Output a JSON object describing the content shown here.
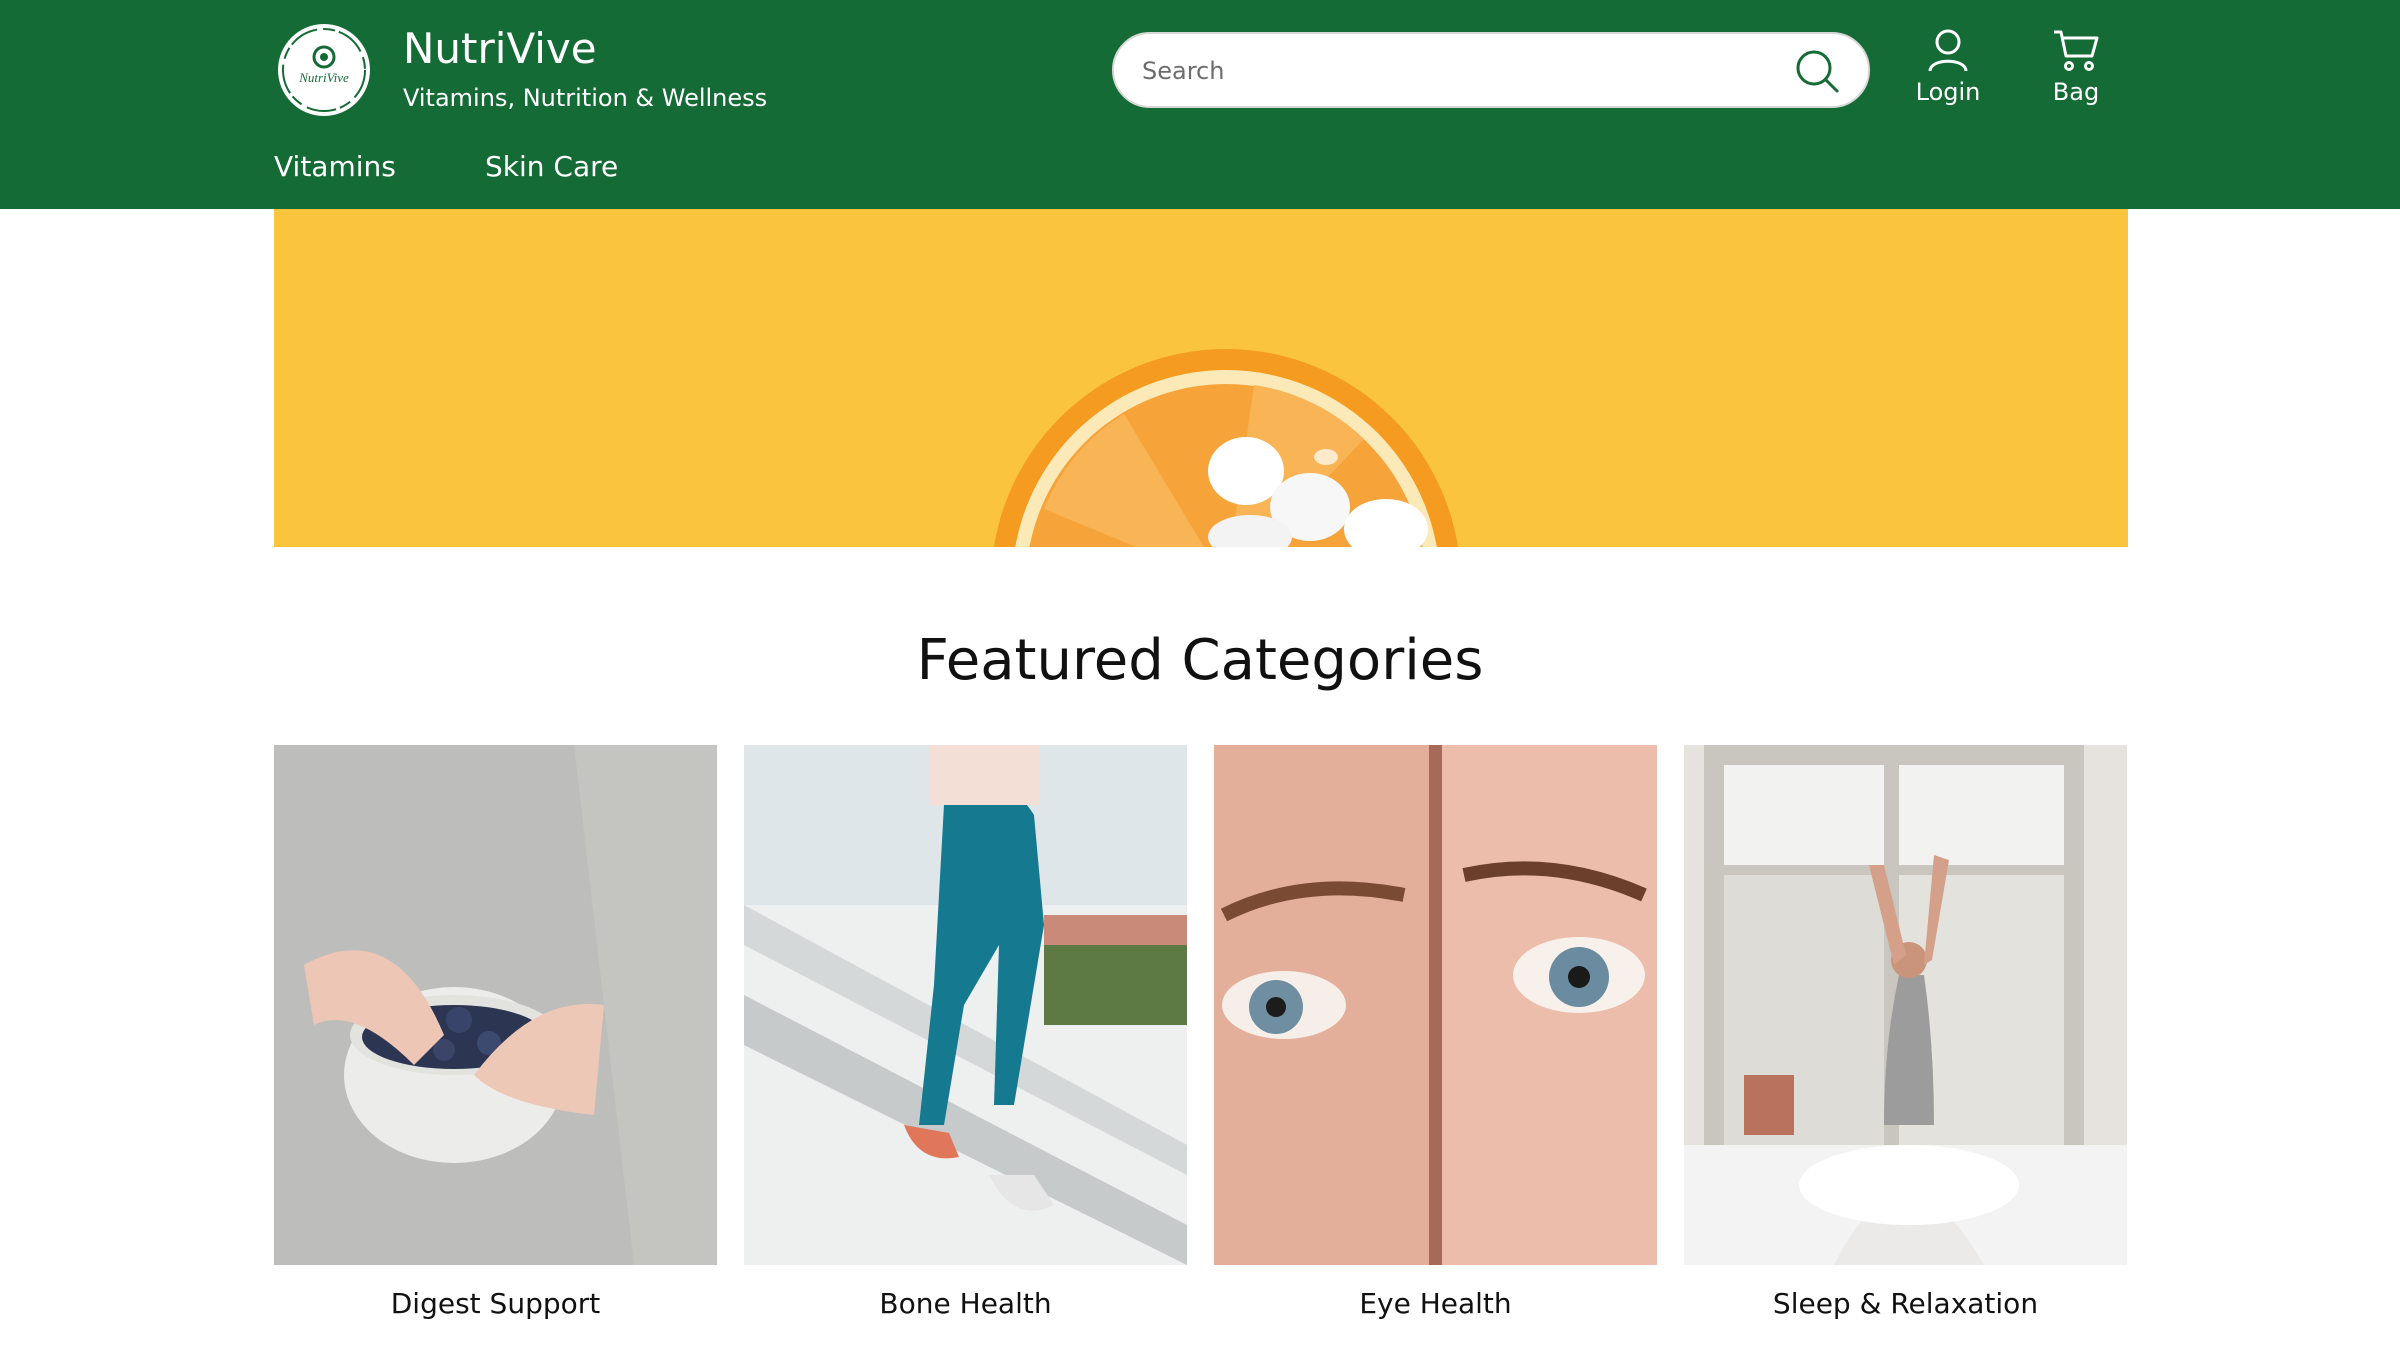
{
  "brand": {
    "name": "NutriVive",
    "tagline": "Vitamins, Nutrition & Wellness",
    "logo_text": "NutriVive"
  },
  "search": {
    "placeholder": "Search",
    "icon": "search-icon"
  },
  "header_actions": [
    {
      "label": "Login",
      "icon": "user-icon"
    },
    {
      "label": "Bag",
      "icon": "cart-icon"
    }
  ],
  "nav": [
    "Vitamins",
    "Skin Care"
  ],
  "featured": {
    "title": "Featured Categories",
    "categories": [
      {
        "label": "Digest Support"
      },
      {
        "label": "Bone Health"
      },
      {
        "label": "Eye Health"
      },
      {
        "label": "Sleep & Relaxation"
      }
    ]
  },
  "colors": {
    "header": "#156b36",
    "hero": "#fbc43d"
  }
}
